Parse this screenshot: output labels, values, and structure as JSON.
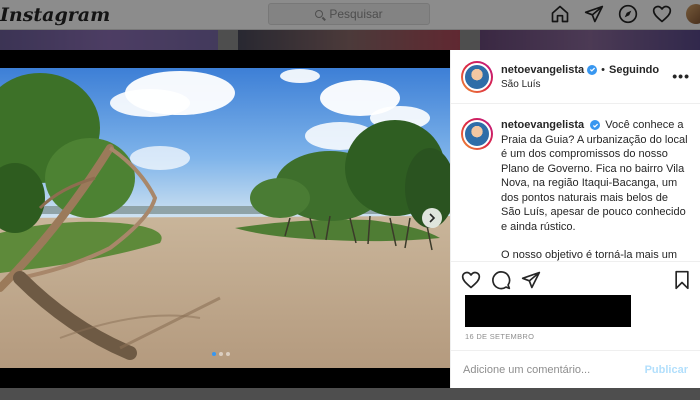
{
  "app": {
    "logo": "Instagram",
    "search_placeholder": "Pesquisar"
  },
  "post": {
    "username": "netoevangelista",
    "follow_status": "Seguindo",
    "separator": "•",
    "location": "São Luís",
    "more": "•••",
    "caption_paragraphs": [
      "Você conhece a Praia da Guia? A urbanização do local é um dos compromissos do nosso Plano de Governo. Fica no bairro Vila Nova, na região Itaqui-Bacanga, um dos pontos naturais mais belos de São Luís, apesar de pouco conhecido e ainda rústico.",
      "O nosso objetivo é torná-la mais um"
    ],
    "date": "16 DE SETEMBRO",
    "carousel": {
      "slides": 3,
      "active_index": 0
    }
  },
  "comment": {
    "placeholder": "Adicione um comentário...",
    "post_label": "Publicar"
  },
  "colors": {
    "accent": "#3897f0",
    "post_button_disabled": "#b2dffc",
    "muted": "#8e8e8e"
  },
  "icons": [
    "home-icon",
    "direct-icon",
    "explore-icon",
    "heart-icon",
    "search-icon",
    "chevron-right-icon",
    "like-icon",
    "comment-icon",
    "share-icon",
    "bookmark-icon",
    "verified-icon",
    "more-icon"
  ]
}
